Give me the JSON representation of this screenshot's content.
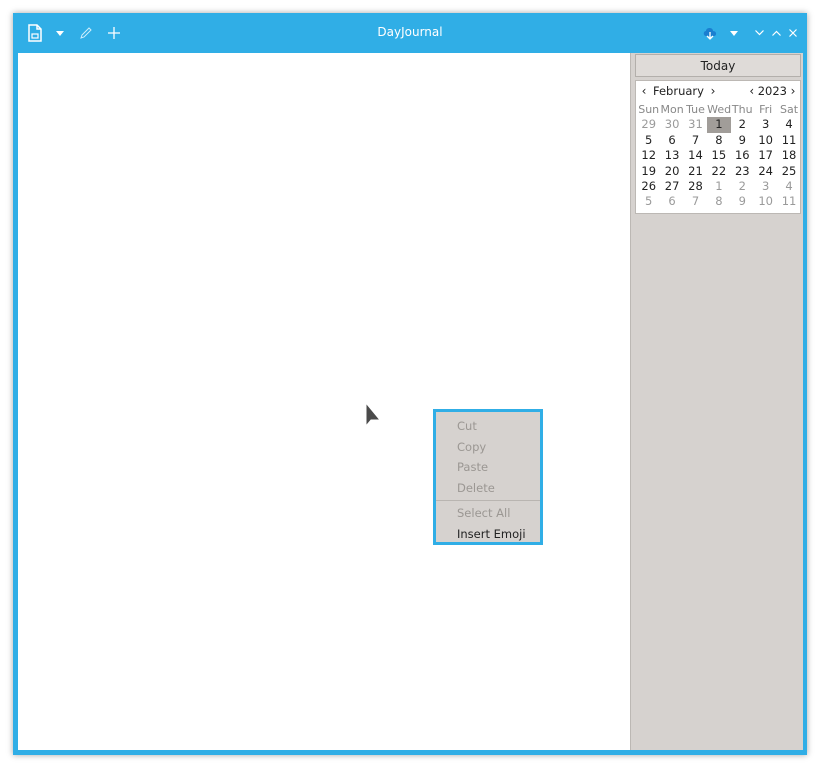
{
  "app": {
    "title": "DayJournal"
  },
  "toolbar": {
    "new_icon": "new-document-icon",
    "dropdown_icon": "caret-down-icon",
    "edit_icon": "pencil-icon",
    "add_icon": "plus-icon"
  },
  "window_controls": {
    "sync_icon": "cloud-download-icon",
    "minimize": "minimize-icon",
    "maximize": "maximize-icon",
    "close": "close-icon"
  },
  "sidebar": {
    "today_label": "Today",
    "calendar": {
      "month": "February",
      "year": "2023",
      "weekdays": [
        "Sun",
        "Mon",
        "Tue",
        "Wed",
        "Thu",
        "Fri",
        "Sat"
      ],
      "weeks": [
        [
          {
            "d": "29",
            "dim": true
          },
          {
            "d": "30",
            "dim": true
          },
          {
            "d": "31",
            "dim": true
          },
          {
            "d": "1",
            "sel": true
          },
          {
            "d": "2"
          },
          {
            "d": "3"
          },
          {
            "d": "4"
          }
        ],
        [
          {
            "d": "5"
          },
          {
            "d": "6"
          },
          {
            "d": "7"
          },
          {
            "d": "8"
          },
          {
            "d": "9"
          },
          {
            "d": "10"
          },
          {
            "d": "11"
          }
        ],
        [
          {
            "d": "12"
          },
          {
            "d": "13"
          },
          {
            "d": "14"
          },
          {
            "d": "15"
          },
          {
            "d": "16"
          },
          {
            "d": "17"
          },
          {
            "d": "18"
          }
        ],
        [
          {
            "d": "19"
          },
          {
            "d": "20"
          },
          {
            "d": "21"
          },
          {
            "d": "22"
          },
          {
            "d": "23"
          },
          {
            "d": "24"
          },
          {
            "d": "25"
          }
        ],
        [
          {
            "d": "26"
          },
          {
            "d": "27"
          },
          {
            "d": "28"
          },
          {
            "d": "1",
            "dim": true
          },
          {
            "d": "2",
            "dim": true
          },
          {
            "d": "3",
            "dim": true
          },
          {
            "d": "4",
            "dim": true
          }
        ],
        [
          {
            "d": "5",
            "dim": true
          },
          {
            "d": "6",
            "dim": true
          },
          {
            "d": "7",
            "dim": true
          },
          {
            "d": "8",
            "dim": true
          },
          {
            "d": "9",
            "dim": true
          },
          {
            "d": "10",
            "dim": true
          },
          {
            "d": "11",
            "dim": true
          }
        ]
      ]
    }
  },
  "context_menu": {
    "items": [
      {
        "label": "Cut",
        "enabled": false
      },
      {
        "label": "Copy",
        "enabled": false
      },
      {
        "label": "Paste",
        "enabled": false
      },
      {
        "label": "Delete",
        "enabled": false
      },
      {
        "label": "Select All",
        "enabled": false
      },
      {
        "label": "Insert Emoji",
        "enabled": true
      }
    ]
  },
  "colors": {
    "accent": "#30aee6",
    "panel": "#d6d2cf",
    "selected_day": "#a19d99"
  }
}
